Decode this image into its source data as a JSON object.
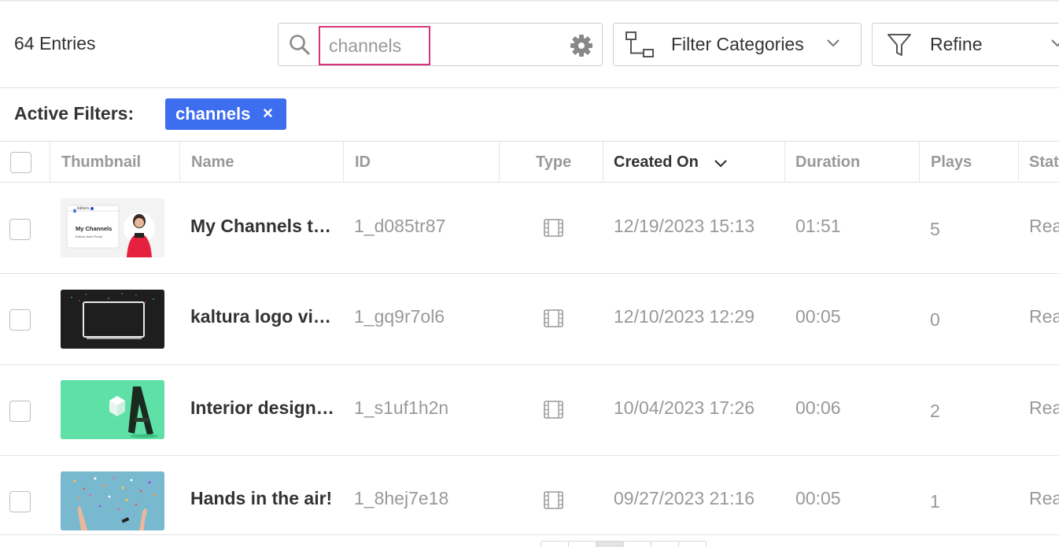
{
  "toolbar": {
    "entries_count": "64 Entries",
    "search": {
      "value": "",
      "placeholder": "channels"
    },
    "filter_categories_label": "Filter Categories",
    "refine_label": "Refine"
  },
  "active_filters": {
    "label": "Active Filters:",
    "chips": [
      {
        "label": "channels",
        "remove_glyph": "×"
      }
    ]
  },
  "table": {
    "columns": [
      "Thumbnail",
      "Name",
      "ID",
      "Type",
      "Created On",
      "Duration",
      "Plays",
      "Stat"
    ],
    "sorted_column": "Created On",
    "sort_direction": "desc",
    "rows": [
      {
        "name": "My Channels t…",
        "id": "1_d085tr87",
        "type_icon": "video-icon",
        "created": "12/19/2023 15:13",
        "duration": "01:51",
        "plays": "5",
        "status": "Rea",
        "thumb": {
          "title": "My Channels",
          "subtitle": "Kaltura Video Portal",
          "brand": "kaltura"
        }
      },
      {
        "name": "kaltura logo vi…",
        "id": "1_gq9r7ol6",
        "type_icon": "video-icon",
        "created": "12/10/2023 12:29",
        "duration": "00:05",
        "plays": "0",
        "status": "Rea"
      },
      {
        "name": "Interior design …",
        "id": "1_s1uf1h2n",
        "type_icon": "video-icon",
        "created": "10/04/2023 17:26",
        "duration": "00:06",
        "plays": "2",
        "status": "Rea"
      },
      {
        "name": "Hands in the air!",
        "id": "1_8hej7e18",
        "type_icon": "video-icon",
        "created": "09/27/2023 21:16",
        "duration": "00:05",
        "plays": "1",
        "status": "Rea"
      }
    ]
  },
  "colors": {
    "search_highlight": "#d6347a",
    "chip_bg": "#3e6ef0",
    "muted_text": "#999999"
  }
}
